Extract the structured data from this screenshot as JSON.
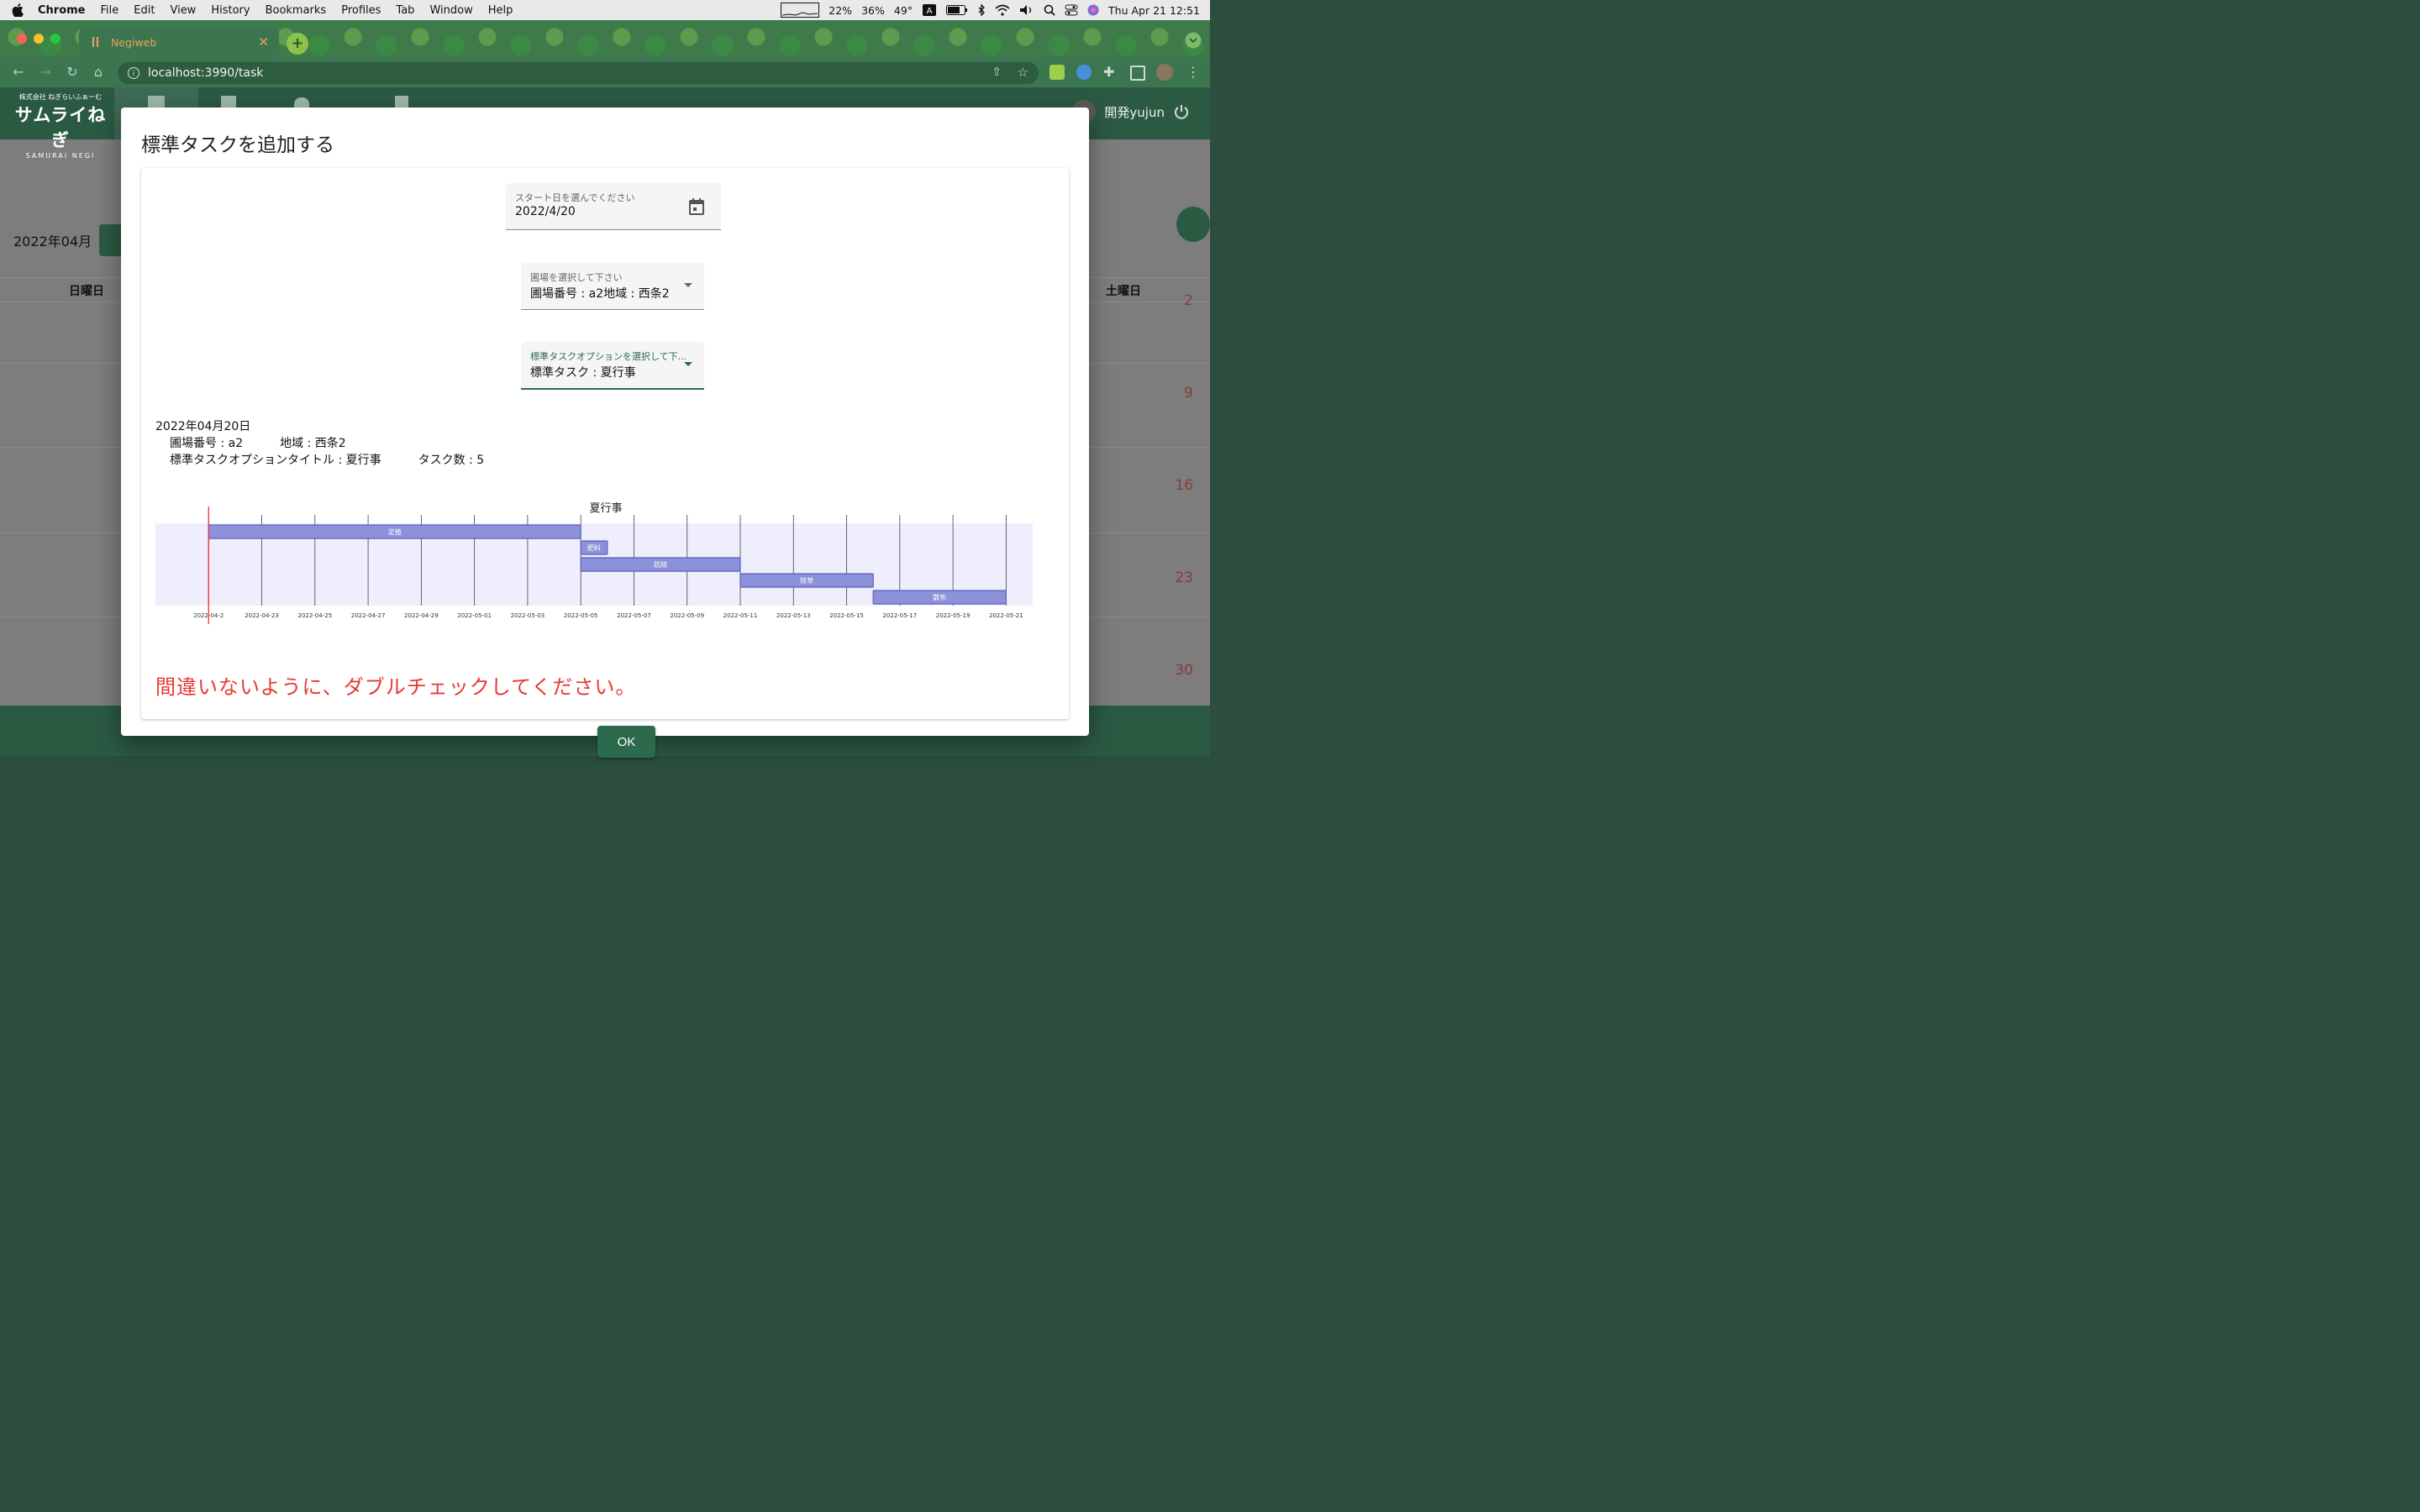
{
  "menubar": {
    "app": "Chrome",
    "items": [
      "File",
      "Edit",
      "View",
      "History",
      "Bookmarks",
      "Profiles",
      "Tab",
      "Window",
      "Help"
    ],
    "status": {
      "ram": "22%",
      "ssd": "36%",
      "cpu_temp": "49°",
      "datetime": "Thu Apr 21  12:51"
    }
  },
  "browser": {
    "tab_title": "Negiweb",
    "url": "localhost:3990/task"
  },
  "app": {
    "logo": {
      "line1": "株式会社 ねぎらいふぁーむ",
      "line2": "サムライねぎ",
      "line3": "SAMURAI NEGI"
    },
    "user": "開発yujun",
    "calendar": {
      "month": "2022年04月",
      "weekday_first": "日曜日",
      "weekday_last": "土曜日",
      "days": [
        "2",
        "9",
        "16",
        "23",
        "30"
      ]
    }
  },
  "dialog": {
    "title": "標準タスクを追加する",
    "start_date": {
      "label": "スタート日を選んでください",
      "value": "2022/4/20"
    },
    "field_select": {
      "label": "圃場を選択して下さい",
      "value": "圃場番号 : a2地域 : 西条2"
    },
    "option_select": {
      "label": "標準タスクオプションを選択して下...",
      "value": "標準タスク : 夏行事"
    },
    "summary": {
      "date": "2022年04月20日",
      "field_no": "圃場番号 : a2",
      "area": "地域 : 西条2",
      "option_title": "標準タスクオプションタイトル : 夏行事",
      "task_count": "タスク数 : 5"
    },
    "warning": "間違いないように、ダブルチェックしてください。",
    "ok_label": "OK"
  },
  "colors": {
    "accent": "#2b6a4c",
    "warning": "#e53935",
    "bar": "#8c91d9"
  },
  "chart_data": {
    "type": "gantt",
    "title": "夏行事",
    "x_ticks": [
      "2022-04-2",
      "2022-04-23",
      "2022-04-25",
      "2022-04-27",
      "2022-04-29",
      "2022-05-01",
      "2022-05-03",
      "2022-05-05",
      "2022-05-07",
      "2022-05-09",
      "2022-05-11",
      "2022-05-13",
      "2022-05-15",
      "2022-05-17",
      "2022-05-19",
      "2022-05-21"
    ],
    "xlim": [
      "2022-04-19",
      "2022-05-22"
    ],
    "today": "2022-04-21",
    "tasks": [
      {
        "name": "定植",
        "start": "2022-04-21",
        "end": "2022-05-05"
      },
      {
        "name": "肥料",
        "start": "2022-05-05",
        "end": "2022-05-06"
      },
      {
        "name": "防除",
        "start": "2022-05-05",
        "end": "2022-05-11"
      },
      {
        "name": "除草",
        "start": "2022-05-11",
        "end": "2022-05-16"
      },
      {
        "name": "散布",
        "start": "2022-05-16",
        "end": "2022-05-21"
      }
    ]
  }
}
